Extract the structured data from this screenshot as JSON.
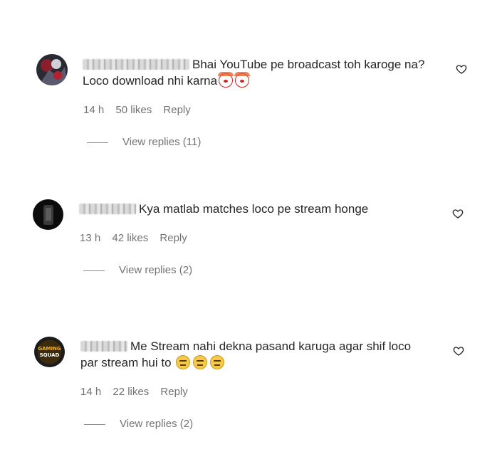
{
  "comments": [
    {
      "text_line1": "Bhai YouTube pe broadcast toh karoge na?",
      "text_line2": "Loco download nhi karna",
      "emojis": [
        "clown",
        "clown"
      ],
      "time": "14 h",
      "likes": "50 likes",
      "reply": "Reply",
      "view_replies": "View replies (11)"
    },
    {
      "text_line1": "Kya matlab matches loco pe stream honge",
      "time": "13 h",
      "likes": "42 likes",
      "reply": "Reply",
      "view_replies": "View replies (2)"
    },
    {
      "text_line1": "Me Stream nahi dekna pasand karuga agar shif loco",
      "text_line2": "par stream hui to",
      "emojis": [
        "neutral-face",
        "neutral-face",
        "neutral-face"
      ],
      "time": "14 h",
      "likes": "22 likes",
      "reply": "Reply",
      "view_replies": "View replies (2)",
      "avatar_text": "GAMING SQUAD"
    }
  ]
}
